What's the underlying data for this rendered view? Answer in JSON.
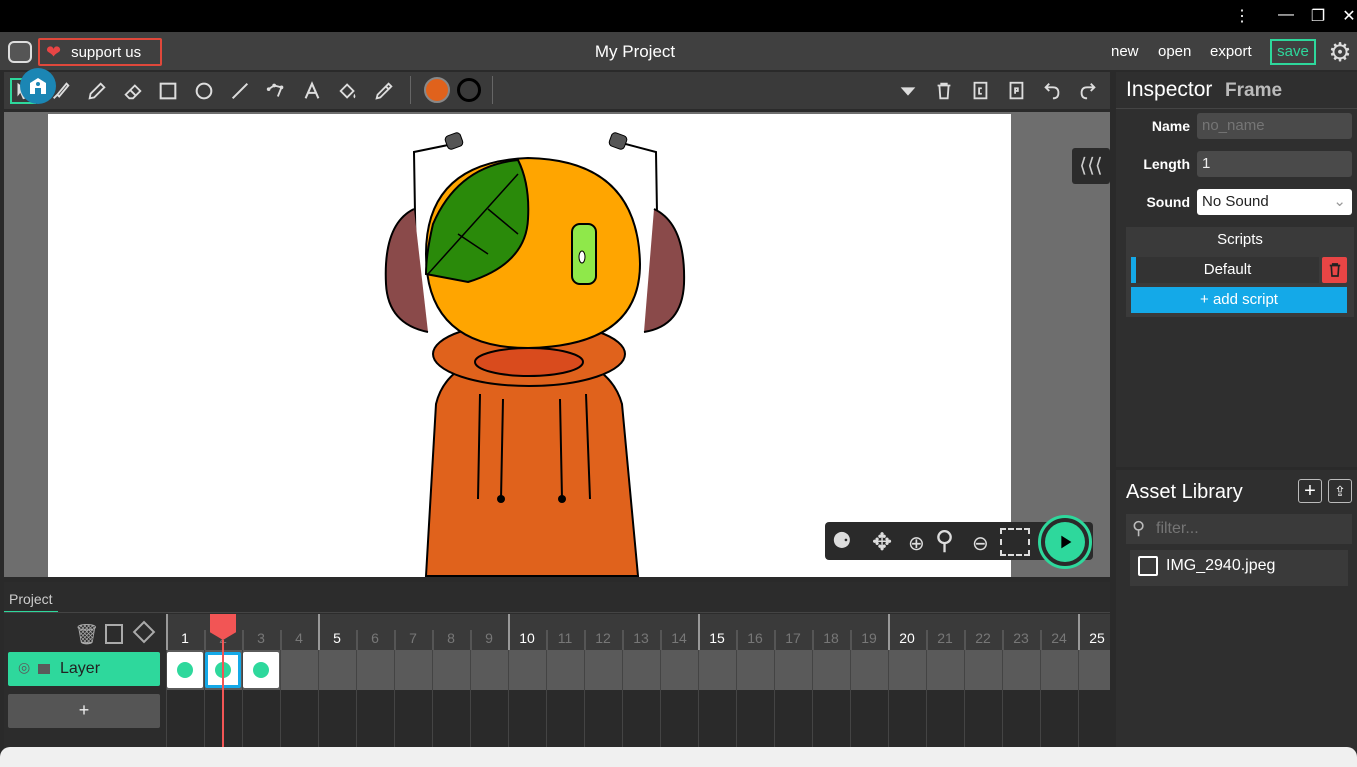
{
  "window": {
    "menu_icon": "⋮",
    "minimize": "—",
    "restore": "❐",
    "close": "✕"
  },
  "header": {
    "support_label": "support us",
    "project_title": "My Project",
    "menu": {
      "new": "new",
      "open": "open",
      "export": "export",
      "save": "save"
    }
  },
  "colors": {
    "fill": "#e0621c",
    "stroke": "#000000",
    "accent": "#2ed89c",
    "danger": "#e84545",
    "script_blue": "#14a9e8"
  },
  "toolbar": {
    "tools": [
      "cursor-icon",
      "brush-icon",
      "pencil-icon",
      "eraser-icon",
      "rectangle-icon",
      "ellipse-icon",
      "line-icon",
      "path-icon",
      "text-icon",
      "fill-icon",
      "eyedropper-icon"
    ]
  },
  "inspector": {
    "title": "Inspector",
    "subtitle": "Frame",
    "name_label": "Name",
    "name_placeholder": "no_name",
    "length_label": "Length",
    "length_value": "1",
    "sound_label": "Sound",
    "sound_value": "No Sound",
    "scripts_title": "Scripts",
    "script_default": "Default",
    "add_script": "+ add script"
  },
  "assets": {
    "title": "Asset Library",
    "filter_placeholder": "filter...",
    "items": [
      "IMG_2940.jpeg"
    ]
  },
  "timeline": {
    "tab": "Project",
    "layer_name": "Layer",
    "add_layer": "+",
    "frames": [
      "1",
      "2",
      "3",
      "4",
      "5",
      "6",
      "7",
      "8",
      "9",
      "10",
      "11",
      "12",
      "13",
      "14",
      "15",
      "16",
      "17",
      "18",
      "19",
      "20",
      "21",
      "22",
      "23",
      "24",
      "25"
    ],
    "current_frame": 2
  }
}
